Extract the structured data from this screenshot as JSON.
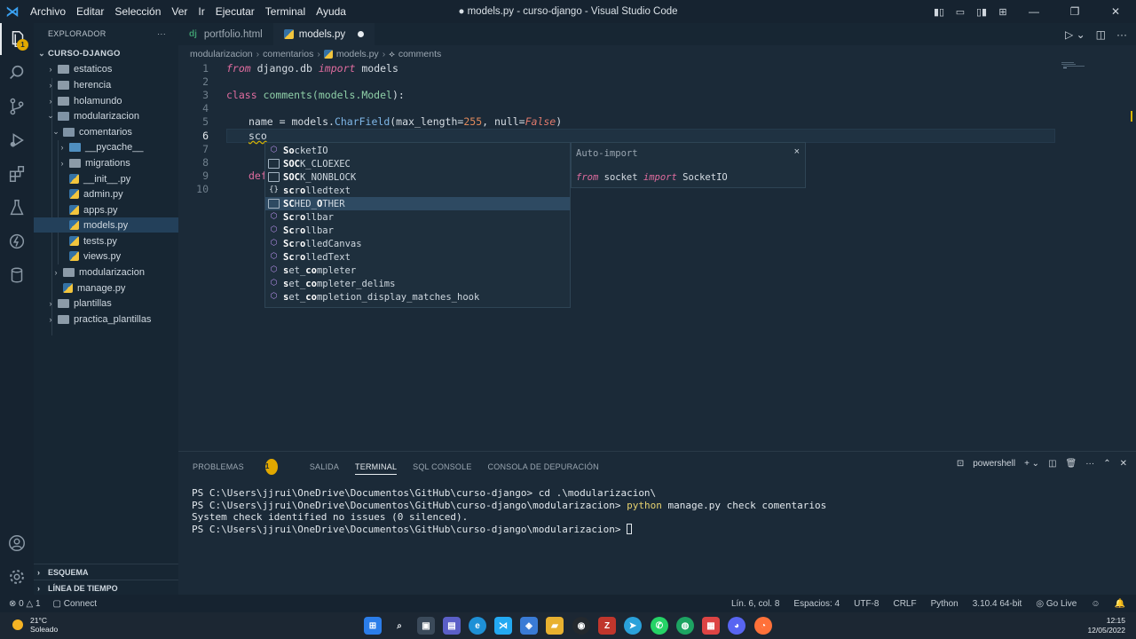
{
  "titlebar": {
    "menu": [
      "Archivo",
      "Editar",
      "Selección",
      "Ver",
      "Ir",
      "Ejecutar",
      "Terminal",
      "Ayuda"
    ],
    "title": "● models.py - curso-django - Visual Studio Code"
  },
  "activity_badge": "1",
  "sidebar": {
    "header": "EXPLORADOR",
    "more": "···",
    "tree": [
      {
        "label": "CURSO-DJANGO",
        "type": "root"
      },
      {
        "label": "estaticos",
        "type": "folder"
      },
      {
        "label": "herencia",
        "type": "folder"
      },
      {
        "label": "holamundo",
        "type": "folder"
      },
      {
        "label": "modularizacion",
        "type": "folder-open"
      },
      {
        "label": "comentarios",
        "type": "folder-open"
      },
      {
        "label": "__pycache__",
        "type": "folder"
      },
      {
        "label": "migrations",
        "type": "folder"
      },
      {
        "label": "__init__.py",
        "type": "py"
      },
      {
        "label": "admin.py",
        "type": "py"
      },
      {
        "label": "apps.py",
        "type": "py"
      },
      {
        "label": "models.py",
        "type": "py",
        "selected": true
      },
      {
        "label": "tests.py",
        "type": "py"
      },
      {
        "label": "views.py",
        "type": "py"
      },
      {
        "label": "modularizacion",
        "type": "folder"
      },
      {
        "label": "manage.py",
        "type": "py"
      },
      {
        "label": "plantillas",
        "type": "folder"
      },
      {
        "label": "practica_plantillas",
        "type": "folder"
      }
    ],
    "sections": [
      "ESQUEMA",
      "LÍNEA DE TIEMPO"
    ]
  },
  "tabs": [
    {
      "label": "portfolio.html",
      "icon": "dj"
    },
    {
      "label": "models.py",
      "icon": "python",
      "modified": true
    }
  ],
  "breadcrumb": [
    "modularizacion",
    "comentarios",
    "models.py",
    "comments"
  ],
  "editor": {
    "line_numbers": [
      "1",
      "2",
      "3",
      "4",
      "5",
      "6",
      "7",
      "8",
      "9",
      "10"
    ],
    "current_line": 6,
    "line1": {
      "kw1": "from",
      "mod": " django.db ",
      "kw2": "import",
      "name": " models"
    },
    "line3": {
      "kw": "class",
      "name": " comments(models.",
      "base": "Model",
      "end": "):"
    },
    "line5": {
      "a": "name = models.",
      "fn": "CharField",
      "b": "(max_length=",
      "num": "255",
      "c": ", null=",
      "bool": "False",
      "d": ")"
    },
    "line6": "sco",
    "line9": "def"
  },
  "suggest": {
    "items": [
      {
        "pre": "So",
        "mid": "",
        "b2": "",
        "rest": "cketIO",
        "icon": "cube",
        "raw": "SocketIO"
      },
      {
        "label": "SOCK_CLOEXEC",
        "icon": "box"
      },
      {
        "label": "SOCK_NONBLOCK",
        "icon": "box"
      },
      {
        "label": "scrolledtext",
        "icon": "brace"
      },
      {
        "label": "SCHED_OTHER",
        "icon": "box"
      },
      {
        "label": "Scrollbar",
        "icon": "cube"
      },
      {
        "label": "Scrollbar",
        "icon": "cube"
      },
      {
        "label": "ScrolledCanvas",
        "icon": "cube"
      },
      {
        "label": "ScrolledText",
        "icon": "cube"
      },
      {
        "label": "set_completer",
        "icon": "cube"
      },
      {
        "label": "set_completer_delims",
        "icon": "cube"
      },
      {
        "label": "set_completion_display_matches_hook",
        "icon": "cube"
      }
    ],
    "detail_title": "Auto-import",
    "detail_close": "×",
    "detail_kw1": "from",
    "detail_mod": " socket ",
    "detail_kw2": "import",
    "detail_name": " SocketIO"
  },
  "panel": {
    "tabs": [
      "PROBLEMAS",
      "SALIDA",
      "TERMINAL",
      "SQL CONSOLE",
      "CONSOLA DE DEPURACIÓN"
    ],
    "problems_count": "1",
    "active_tab": "TERMINAL",
    "shell": "powershell",
    "terminal": {
      "l1": "PS C:\\Users\\jjrui\\OneDrive\\Documentos\\GitHub\\curso-django> cd .\\modularizacion\\",
      "l2a": "PS C:\\Users\\jjrui\\OneDrive\\Documentos\\GitHub\\curso-django\\modularizacion> ",
      "l2b": "python",
      "l2c": " manage.py check comentarios",
      "l3": "System check identified no issues (0 silenced).",
      "l4": "PS C:\\Users\\jjrui\\OneDrive\\Documentos\\GitHub\\curso-django\\modularizacion> "
    }
  },
  "status": {
    "errors": "0",
    "warnings": "1",
    "connect": "Connect",
    "position": "Lín. 6, col. 8",
    "spaces": "Espacios: 4",
    "encoding": "UTF-8",
    "eol": "CRLF",
    "language": "Python",
    "interpreter": "3.10.4 64-bit",
    "golive": "Go Live"
  },
  "taskbar": {
    "temp": "21°C",
    "weather": "Soleado",
    "time": "12:15",
    "date": "12/05/2022"
  }
}
